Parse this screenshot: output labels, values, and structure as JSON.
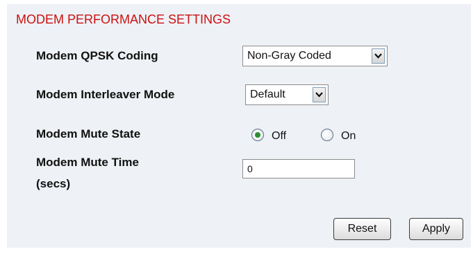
{
  "section": {
    "title": "MODEM PERFORMANCE SETTINGS"
  },
  "qpsk": {
    "label": "Modem QPSK Coding",
    "value": "Non-Gray Coded",
    "arrow_icon": "chevron-down-icon"
  },
  "interleaver": {
    "label": "Modem Interleaver Mode",
    "value": "Default",
    "arrow_icon": "chevron-down-icon"
  },
  "mute_state": {
    "label": "Modem Mute State",
    "options": [
      {
        "label": "Off",
        "selected": true
      },
      {
        "label": "On",
        "selected": false
      }
    ]
  },
  "mute_time": {
    "label_line1": "Modem Mute Time",
    "label_line2": "(secs)",
    "value": "0"
  },
  "buttons": {
    "reset": "Reset",
    "apply": "Apply"
  },
  "colors": {
    "title": "#cc1111",
    "panel_bg": "#eef1f5",
    "radio_selected": "#2c8d2c"
  }
}
